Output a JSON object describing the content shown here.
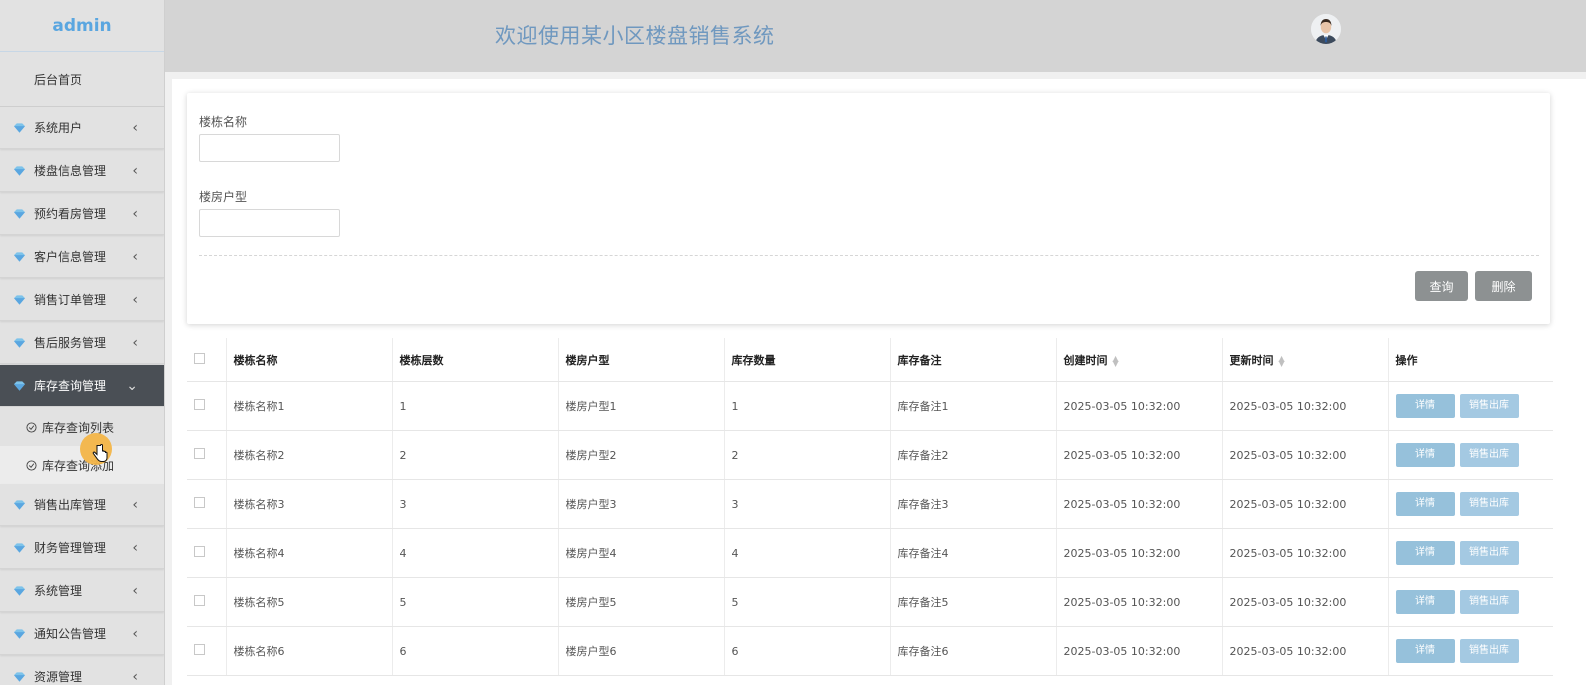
{
  "sidebar": {
    "brand": "admin",
    "home": "后台首页",
    "items": [
      {
        "label": "系统用户"
      },
      {
        "label": "楼盘信息管理"
      },
      {
        "label": "预约看房管理"
      },
      {
        "label": "客户信息管理"
      },
      {
        "label": "销售订单管理"
      },
      {
        "label": "售后服务管理"
      },
      {
        "label": "库存查询管理",
        "active": true
      },
      {
        "label": "销售出库管理"
      },
      {
        "label": "财务管理管理"
      },
      {
        "label": "系统管理"
      },
      {
        "label": "通知公告管理"
      },
      {
        "label": "资源管理"
      }
    ],
    "sub_items": [
      {
        "label": "库存查询列表"
      },
      {
        "label": "库存查询添加"
      }
    ]
  },
  "header": {
    "title": "欢迎使用某小区楼盘销售系统"
  },
  "search": {
    "field1_label": "楼栋名称",
    "field1_value": "",
    "field2_label": "楼房户型",
    "field2_value": "",
    "query_label": "查询",
    "delete_label": "删除"
  },
  "table": {
    "columns": [
      "楼栋名称",
      "楼栋层数",
      "楼房户型",
      "库存数量",
      "库存备注",
      "创建时间",
      "更新时间",
      "操作"
    ],
    "detail_label": "详情",
    "out_label": "销售出库",
    "rows": [
      {
        "name": "楼栋名称1",
        "floors": "1",
        "type": "楼房户型1",
        "qty": "1",
        "note": "库存备注1",
        "created": "2025-03-05 10:32:00",
        "updated": "2025-03-05 10:32:00"
      },
      {
        "name": "楼栋名称2",
        "floors": "2",
        "type": "楼房户型2",
        "qty": "2",
        "note": "库存备注2",
        "created": "2025-03-05 10:32:00",
        "updated": "2025-03-05 10:32:00"
      },
      {
        "name": "楼栋名称3",
        "floors": "3",
        "type": "楼房户型3",
        "qty": "3",
        "note": "库存备注3",
        "created": "2025-03-05 10:32:00",
        "updated": "2025-03-05 10:32:00"
      },
      {
        "name": "楼栋名称4",
        "floors": "4",
        "type": "楼房户型4",
        "qty": "4",
        "note": "库存备注4",
        "created": "2025-03-05 10:32:00",
        "updated": "2025-03-05 10:32:00"
      },
      {
        "name": "楼栋名称5",
        "floors": "5",
        "type": "楼房户型5",
        "qty": "5",
        "note": "库存备注5",
        "created": "2025-03-05 10:32:00",
        "updated": "2025-03-05 10:32:00"
      },
      {
        "name": "楼栋名称6",
        "floors": "6",
        "type": "楼房户型6",
        "qty": "6",
        "note": "库存备注6",
        "created": "2025-03-05 10:32:00",
        "updated": "2025-03-05 10:32:00"
      }
    ]
  },
  "colors": {
    "brand": "#5aa6e0",
    "header_title": "#6f98bf",
    "active_menu": "#4a4f55",
    "detail_button": "#96c1db",
    "gray_button": "#8d9192"
  },
  "icons": {
    "menu": "diamond-icon",
    "collapse": "chevron-left-icon",
    "expand": "chevron-down-icon",
    "sub": "check-circle-icon",
    "cursor": "hand-pointer-icon"
  }
}
